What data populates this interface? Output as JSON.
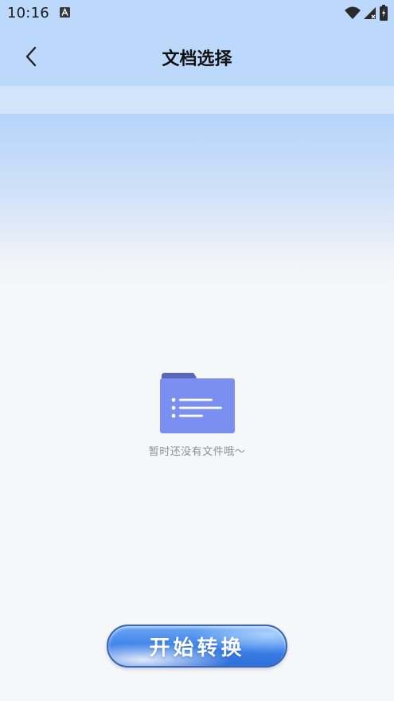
{
  "status_bar": {
    "time": "10:16",
    "icons": [
      "a-notification-icon",
      "wifi-icon",
      "signal-icon",
      "battery-icon"
    ]
  },
  "header": {
    "title": "文档选择",
    "back_icon": "chevron-left-icon"
  },
  "empty_state": {
    "icon": "folder-icon",
    "message": "暂时还没有文件哦～"
  },
  "actions": {
    "start_label": "开始转换"
  },
  "colors": {
    "folder": "#7b8ff0",
    "folder_tab": "#5b67b8",
    "button": "#3b80e8",
    "title_text": "#111111",
    "hint_text": "#8f8f94"
  }
}
